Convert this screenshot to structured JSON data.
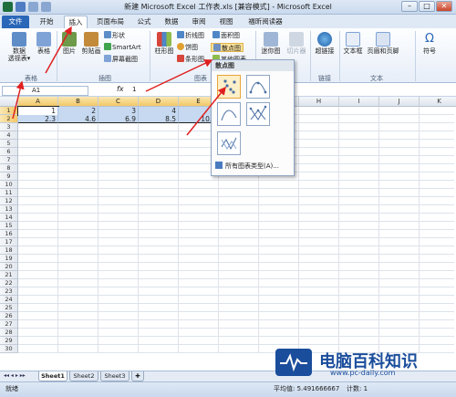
{
  "window": {
    "title": "新建 Microsoft Excel 工作表.xls [兼容模式] - Microsoft Excel",
    "min": "–",
    "max": "□",
    "close": "✕"
  },
  "tabs": [
    "文件",
    "开始",
    "插入",
    "页面布局",
    "公式",
    "数据",
    "审阅",
    "视图",
    "福昕阅读器"
  ],
  "ribbon": {
    "table_group": {
      "pivot": "数据\n透视表",
      "pivot_arrow": "▾",
      "table": "表格",
      "label": "表格"
    },
    "illus_group": {
      "picture": "图片",
      "clipart": "剪贴画",
      "shapes": "形状",
      "smartart": "SmartArt",
      "screenshot": "屏幕截图",
      "label": "插图"
    },
    "chart_group": {
      "column": "柱形图",
      "line": "折线图",
      "pie": "饼图",
      "bar": "条形图",
      "area": "面积图",
      "scatter": "散点图",
      "other": "其他图表",
      "label": "图表"
    },
    "spark_group": {
      "spark": "迷你图",
      "slicer": "切片器"
    },
    "link_group": {
      "hyperlink": "超链接",
      "label": "链接"
    },
    "text_group": {
      "textbox": "文本框",
      "headerfooter": "页眉和页脚",
      "label": "文本"
    },
    "symbol_group": {
      "symbol": "符号"
    }
  },
  "formula": {
    "namebox": "A1",
    "fx": "fx",
    "value": "1"
  },
  "columns": [
    "A",
    "B",
    "C",
    "D",
    "E",
    "F",
    "G",
    "H",
    "I",
    "J",
    "K"
  ],
  "rows": [
    "1",
    "2",
    "3",
    "4",
    "5",
    "6",
    "7",
    "8",
    "9",
    "10",
    "11",
    "12",
    "13",
    "14",
    "15",
    "16",
    "17",
    "18",
    "19",
    "20",
    "21",
    "22",
    "23",
    "24",
    "25",
    "26",
    "27",
    "28",
    "29",
    "30"
  ],
  "cells": {
    "row1": [
      "1",
      "2",
      "3",
      "4",
      "5"
    ],
    "row2": [
      "2.3",
      "4.6",
      "6.9",
      "8.5",
      "10.2"
    ]
  },
  "dropdown": {
    "title": "散点图",
    "more": "所有图表类型(A)..."
  },
  "sheets": [
    "Sheet1",
    "Sheet2",
    "Sheet3"
  ],
  "status": {
    "ready": "就绪",
    "average": "平均值: 5.491666667",
    "count": "计数: 1"
  },
  "watermark": {
    "name": "电脑百科知识",
    "url": "www.pc-daily.com"
  },
  "colors": {
    "ribbon_bg": "#e7eef8",
    "file_tab": "#2a67b8",
    "selection": "#c6d9f0",
    "arrow": "#e02020"
  }
}
